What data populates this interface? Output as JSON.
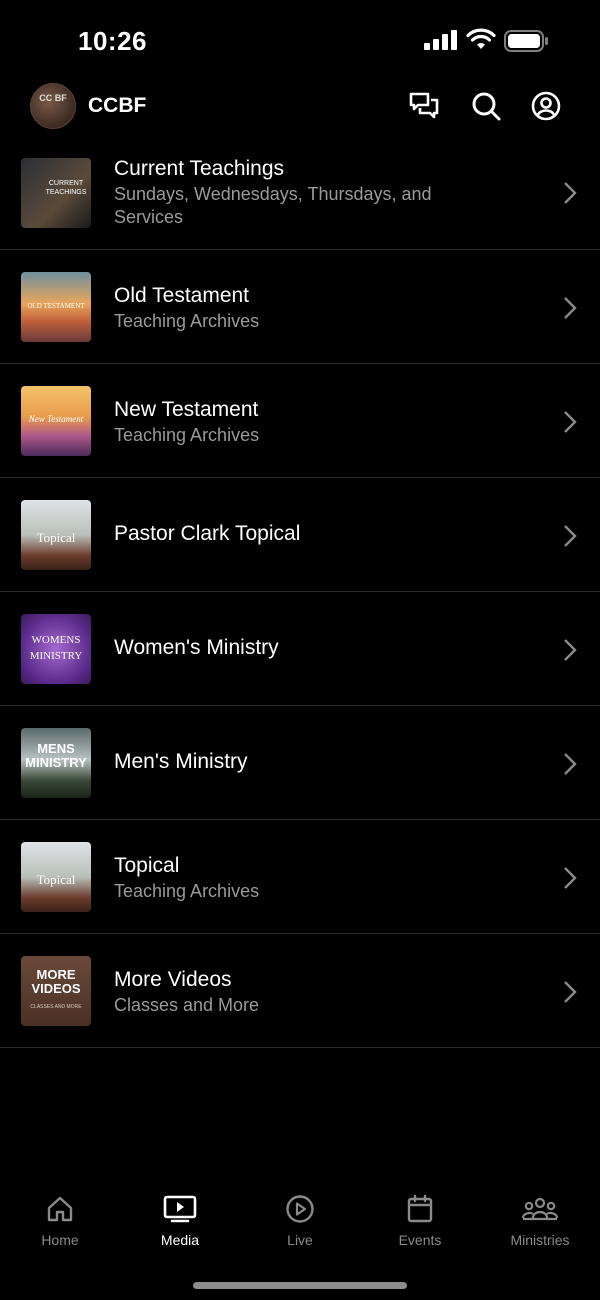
{
  "status": {
    "time": "10:26"
  },
  "header": {
    "brand": "CCBF",
    "logo_text": "CC BF"
  },
  "items": [
    {
      "title": "Current Teachings",
      "subtitle": "Sundays, Wednesdays, Thursdays, and Services",
      "thumb_text": "CURRENT TEACHINGS"
    },
    {
      "title": "Old Testament",
      "subtitle": "Teaching Archives",
      "thumb_text": "OLD TESTAMENT"
    },
    {
      "title": "New Testament",
      "subtitle": "Teaching Archives",
      "thumb_text": "New Testament"
    },
    {
      "title": "Pastor Clark Topical",
      "subtitle": "",
      "thumb_text": "Topical"
    },
    {
      "title": "Women's Ministry",
      "subtitle": "",
      "thumb_text": "WOMENS MINISTRY"
    },
    {
      "title": "Men's Ministry",
      "subtitle": "",
      "thumb_text": "MENS MINISTRY"
    },
    {
      "title": "Topical",
      "subtitle": "Teaching Archives",
      "thumb_text": "Topical"
    },
    {
      "title": "More Videos",
      "subtitle": "Classes and More",
      "thumb_text": "MORE VIDEOS",
      "thumb_sub": "CLASSES AND MORE"
    }
  ],
  "tabs": [
    {
      "label": "Home",
      "icon": "home-icon"
    },
    {
      "label": "Media",
      "icon": "media-icon",
      "active": true
    },
    {
      "label": "Live",
      "icon": "play-icon"
    },
    {
      "label": "Events",
      "icon": "calendar-icon"
    },
    {
      "label": "Ministries",
      "icon": "people-icon"
    }
  ],
  "colors": {
    "background": "#000000",
    "text": "#ffffff",
    "subtext": "#9a9a9a",
    "divider": "#2b2b2b",
    "inactive_tab": "#8a8a8a"
  }
}
